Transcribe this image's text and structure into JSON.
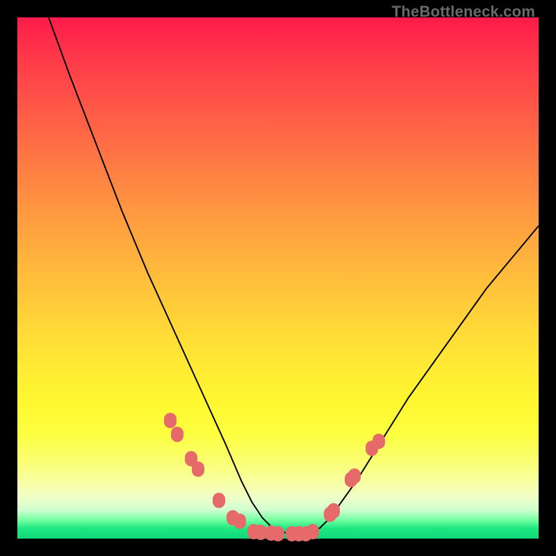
{
  "watermark": "TheBottleneck.com",
  "chart_data": {
    "type": "line",
    "title": "",
    "xlabel": "",
    "ylabel": "",
    "xlim": [
      0,
      100
    ],
    "ylim": [
      0,
      100
    ],
    "grid": false,
    "series": [
      {
        "name": "curve",
        "x": [
          6,
          10,
          15,
          20,
          25,
          30,
          35,
          40,
          43,
          45,
          47,
          49,
          50,
          52,
          54,
          56,
          58,
          60,
          65,
          70,
          75,
          80,
          85,
          90,
          95,
          100
        ],
        "y": [
          100,
          89,
          76,
          63,
          51,
          40,
          29,
          18,
          11,
          7,
          4,
          2,
          1.5,
          1,
          1,
          1.5,
          2,
          4,
          11,
          19,
          27,
          34,
          41,
          48,
          54,
          60
        ]
      }
    ],
    "markers": {
      "name": "highlight-points",
      "x": [
        29.3,
        30.7,
        33.3,
        34.7,
        38.7,
        41.3,
        42.7,
        45.3,
        46.7,
        48.7,
        50,
        52.7,
        54,
        55.3,
        56.7,
        60,
        60.7,
        64,
        64.7,
        68,
        69.3
      ],
      "y": [
        22.7,
        20,
        15.3,
        13.3,
        7.3,
        4,
        3.3,
        1.3,
        1.2,
        1.1,
        1,
        1,
        1,
        1,
        1.3,
        4.7,
        5.3,
        11.3,
        12,
        17.3,
        18.7
      ]
    },
    "annotations": []
  },
  "colors": {
    "marker": "#e66a6a",
    "curve": "#000000"
  }
}
